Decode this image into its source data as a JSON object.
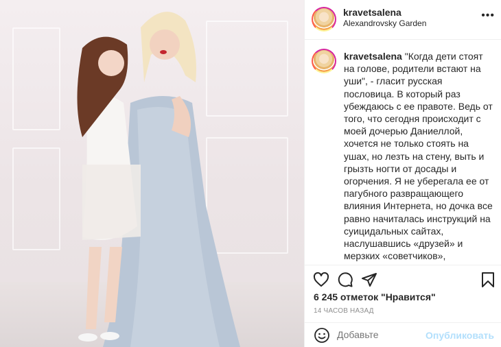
{
  "post": {
    "username": "kravetsalena",
    "location": "Alexandrovsky Garden",
    "caption_user": "kravetsalena",
    "caption_text": " \"Когда дети стоят на голове, родители встают на уши\", - гласит русская пословица. В который раз убеждаюсь с ее правоте. Ведь от того, что сегодня происходит с моей дочерью Даниеллой, хочется не только стоять на ушах, но лезть на стену, выть и грызть ногти от досады и огорчения. Я не уберегала ее от пагубного развращающего влияния Интернета, но дочка все равно начиталась инструкций на суицидальных сайтах, наслушавшись «друзей» и мерзких «советчиков», попыталась то ли демонстративно покалечить себя, то ли, что ужасно, наложить на себя руки. Подробности опущу, потому что это страшно. Но еще страшнее видеть, что сделала с собой девочка. Я понимаю, что это",
    "likes": "6 245 отметок \"Нравится\"",
    "timestamp": "14 ЧАСОВ НАЗАД",
    "comment_placeholder": "Добавьте",
    "publish_label": "Опубликовать"
  },
  "icons": {
    "more": "more-icon",
    "like": "heart-icon",
    "comment": "comment-icon",
    "share": "share-icon",
    "save": "bookmark-icon",
    "emoji": "emoji-icon"
  },
  "colors": {
    "text": "#262626",
    "muted": "#8e8e8e",
    "publish_disabled": "#b2dffc",
    "border": "#efefef"
  }
}
